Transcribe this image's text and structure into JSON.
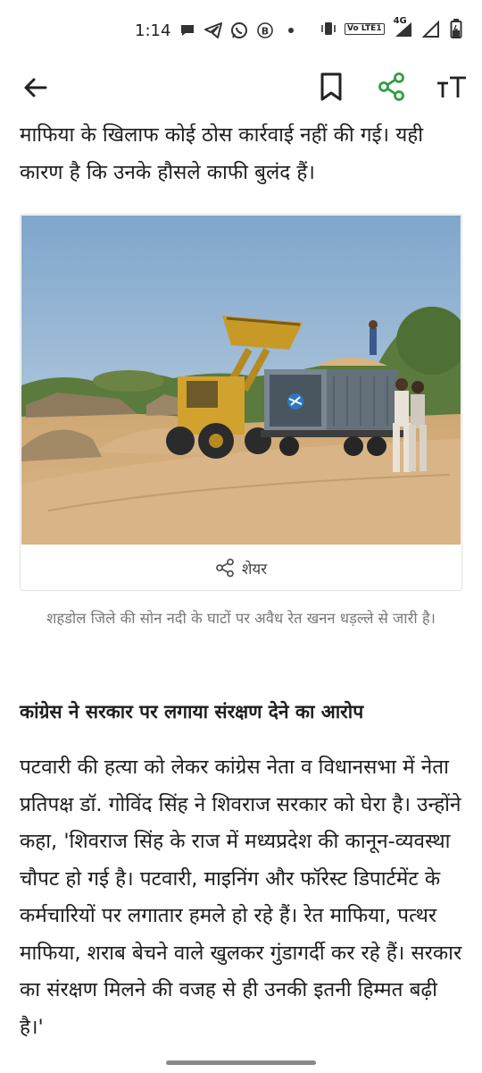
{
  "status_bar": {
    "time": "1:14",
    "left_icons": [
      "chat-bubble-icon",
      "telegram-icon",
      "whatsapp-icon",
      "b-icon",
      "dot-icon"
    ],
    "volte_label": "Vo LTE1",
    "network_label": "4G",
    "right_icons": [
      "vibrate-icon",
      "volte-icon",
      "signal-icon",
      "signal-icon",
      "battery-charging-icon"
    ]
  },
  "app_bar": {
    "back_icon": "arrow-left-icon",
    "bookmark_icon": "bookmark-icon",
    "share_icon": "share-icon",
    "text_size_label": "тT",
    "accent_color": "#2e9e3e"
  },
  "article": {
    "intro_paragraph": "माफिया के खिलाफ कोई ठोस कार्रवाई नहीं की गई। यही कारण है कि उनके हौसले काफी बुलंद हैं।",
    "image": {
      "share_label": "शेयर",
      "caption": "शहडोल जिले की सोन नदी के घाटों पर अवैध रेत खनन धड़ल्ले से जारी है।"
    },
    "subheading": "कांग्रेस ने सरकार पर लगाया संरक्षण देने का आरोप",
    "body_paragraph": "पटवारी की हत्या को लेकर कांग्रेस नेता व विधानसभा में नेता प्रतिपक्ष डॉ. गोविंद सिंह ने शिवराज सरकार को घेरा है। उन्होंने कहा, 'शिवराज सिंह के राज में मध्यप्रदेश की कानून-व्यवस्था चौपट हो गई है। पटवारी, माइनिंग और फॉरेस्ट डिपार्टमेंट के कर्मचारियों पर लगातार हमले हो रहे हैं। रेत माफिया, पत्थर माफिया, शराब बेचने वाले खुलकर गुंडागर्दी कर रहे हैं। सरकार का संरक्षण मिलने की वजह से ही उनकी इतनी हिम्मत बढ़ी है।'"
  }
}
